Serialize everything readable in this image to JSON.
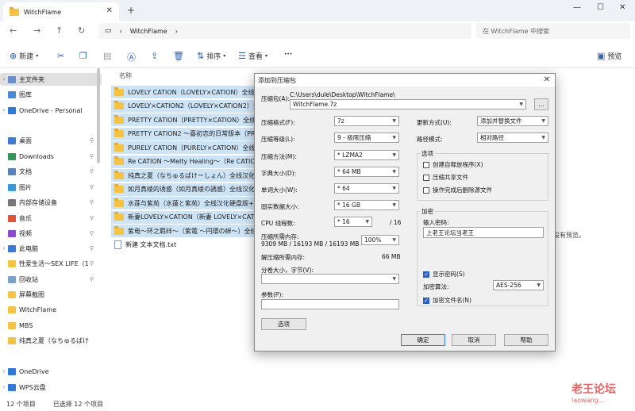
{
  "window": {
    "tab_title": "WitchFlame",
    "search_placeholder": "在 WitchFlame 中搜索",
    "breadcrumb": "WitchFlame"
  },
  "toolbar": {
    "new_label": "新建",
    "sort_label": "排序",
    "view_label": "查看",
    "more_label": "···",
    "preview_label": "预览"
  },
  "sidebar": {
    "items": [
      {
        "label": "主文件夹",
        "icon": "home-icon"
      },
      {
        "label": "图库",
        "icon": "gallery-icon"
      },
      {
        "label": "OneDrive - Personal",
        "icon": "cloud-icon"
      },
      {
        "label": "桌面",
        "icon": "desktop-icon"
      },
      {
        "label": "Downloads",
        "icon": "download-icon"
      },
      {
        "label": "文档",
        "icon": "document-icon"
      },
      {
        "label": "图片",
        "icon": "pictures-icon"
      },
      {
        "label": "内部存储设备",
        "icon": "drive-icon"
      },
      {
        "label": "音乐",
        "icon": "music-icon"
      },
      {
        "label": "视频",
        "icon": "video-icon"
      },
      {
        "label": "此电脑",
        "icon": "pc-icon"
      },
      {
        "label": "性爱生活～SEX LIFE（1",
        "icon": "folder-icon"
      },
      {
        "label": "回收站",
        "icon": "recycle-icon"
      },
      {
        "label": "屏幕截图",
        "icon": "folder-icon"
      },
      {
        "label": "WitchFlame",
        "icon": "folder-icon"
      },
      {
        "label": "MBS",
        "icon": "folder-icon"
      },
      {
        "label": "纯真之夏（なちゅるばけ",
        "icon": "folder-icon"
      },
      {
        "label": "OneDrive",
        "icon": "cloud-icon"
      },
      {
        "label": "WPS云盘",
        "icon": "cloud-icon"
      }
    ]
  },
  "files": {
    "column_name": "名称",
    "rows": [
      "LOVELY CATION（LOVELY×CATION）全线...",
      "LOVELY×CATION2（LOVELY×CATION2）全...",
      "PRETTY CATION（PRETTY×CATION）全线...",
      "PRETTY CATION2 ～喜初恋的日常版本（PRET...",
      "PURELY CATION（PURELY×CATION）全线...",
      "Re CATION ～Melty Healing～（Re CATION...",
      "纯真之夏（なちゅるばけーしょん）全线汉化...",
      "如月真绫的诱惑（如月真绫の誘惑）全线汉化...",
      "水莲与紫苑（水蓮と紫苑）全线汉化硬盘版+全...",
      "新妻LOVELY×CATION（新妻 LOVELY×CATI...",
      "紫电～环之羁绊～（紫電 ～円環の絆～）全线...",
      "新建 文本文档.txt"
    ],
    "preview_message": "没有预览。"
  },
  "status": {
    "count": "12 个项目",
    "selected": "已选择 12 个项目"
  },
  "dialog": {
    "title": "添加到压缩包",
    "archive_label": "压缩包(A):",
    "archive_path": "C:\\Users\\dule\\Desktop\\WitchFlame\\",
    "archive_name": "WitchFlame.7z",
    "browse": "...",
    "format_label": "压缩格式(F):",
    "format_value": "7z",
    "level_label": "压缩等级(L):",
    "level_value": "9 - 极限压缩",
    "method_label": "压缩方法(M):",
    "method_value": "* LZMA2",
    "dict_label": "字典大小(D):",
    "dict_value": "* 64 MB",
    "word_label": "单词大小(W):",
    "word_value": "* 64",
    "solid_label": "固实数据大小:",
    "solid_value": "* 16 GB",
    "threads_label": "CPU 线程数:",
    "threads_value": "* 16",
    "threads_max": "/ 16",
    "mem_comp_label": "压缩所需内存:",
    "mem_comp_value": "9309 MB / 16193 MB / 16193 MB",
    "mem_percent": "100%",
    "mem_decomp_label": "解压缩所需内存:",
    "mem_decomp_value": "66 MB",
    "split_label": "分卷大小，字节(V):",
    "params_label": "参数(P):",
    "options_btn": "选项",
    "update_label": "更新方式(U):",
    "update_value": "添加并替换文件",
    "path_label": "路径模式:",
    "path_value": "相对路径",
    "options_group": "选项",
    "opt_sfx": "创建自释放程序(X)",
    "opt_shared": "压缩共享文件",
    "opt_delete": "操作完成后删除源文件",
    "encrypt_group": "加密",
    "password_label": "输入密码:",
    "password_value": "上老王论坛当老王",
    "show_password": "显示密码(S)",
    "enc_method_label": "加密算法:",
    "enc_method_value": "AES-256",
    "enc_names": "加密文件名(N)",
    "ok": "确定",
    "cancel": "取消",
    "help": "帮助"
  },
  "watermark": {
    "title": "老王论坛",
    "url": "laowang..."
  }
}
